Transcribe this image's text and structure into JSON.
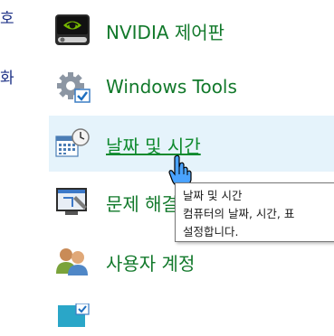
{
  "left_column": {
    "frag1": "호",
    "frag2": "화"
  },
  "items": [
    {
      "label": "NVIDIA 제어판",
      "icon": "nvidia-icon"
    },
    {
      "label": "Windows Tools",
      "icon": "windows-tools-icon"
    },
    {
      "label": "날짜 및 시간",
      "icon": "date-time-icon"
    },
    {
      "label": "문제 해결",
      "icon": "troubleshooting-icon"
    },
    {
      "label": "사용자 계정",
      "icon": "user-accounts-icon"
    },
    {
      "label": "",
      "icon": "next-item-icon"
    }
  ],
  "tooltip": {
    "title": "날짜 및 시간",
    "line2": "컴퓨터의 날짜, 시간, 표",
    "line3": "설정합니다."
  },
  "colors": {
    "link": "#12792b",
    "hover_bg": "#e5f3fb"
  }
}
